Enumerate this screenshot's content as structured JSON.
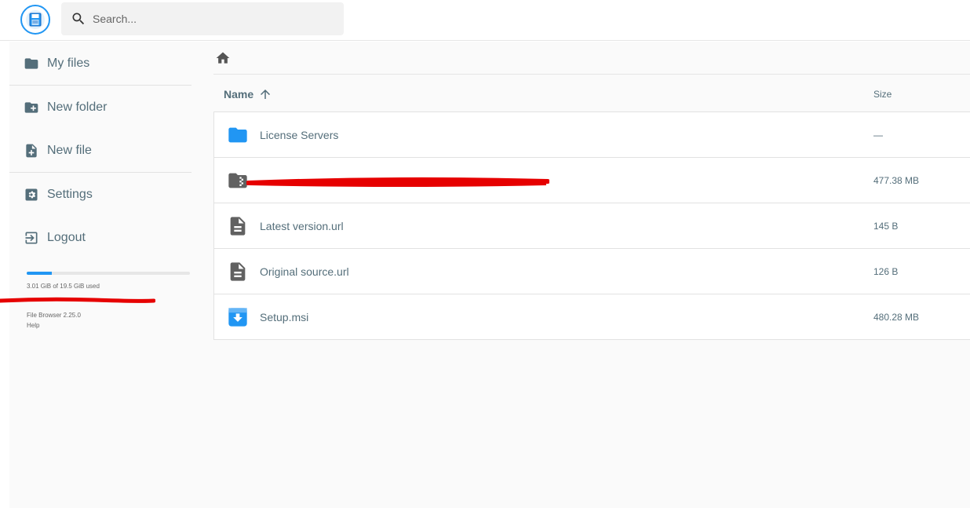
{
  "header": {
    "search_placeholder": "Search..."
  },
  "sidebar": {
    "items": [
      {
        "label": "My files",
        "icon": "folder-icon"
      },
      {
        "label": "New folder",
        "icon": "create-new-folder-icon"
      },
      {
        "label": "New file",
        "icon": "note-add-icon"
      },
      {
        "label": "Settings",
        "icon": "settings-icon"
      },
      {
        "label": "Logout",
        "icon": "logout-icon"
      }
    ],
    "usage": {
      "text": "3.01 GiB of 19.5 GiB used",
      "fraction": 0.154
    },
    "version": "File Browser 2.25.0",
    "help": "Help"
  },
  "list": {
    "header": {
      "name": "Name",
      "size": "Size"
    },
    "rows": [
      {
        "name": "License Servers",
        "size": "—",
        "icon": "folder-icon"
      },
      {
        "name": "",
        "size": "477.38 MB",
        "icon": "archive-icon"
      },
      {
        "name": "Latest version.url",
        "size": "145 B",
        "icon": "file-icon"
      },
      {
        "name": "Original source.url",
        "size": "126 B",
        "icon": "file-icon"
      },
      {
        "name": "Setup.msi",
        "size": "480.28 MB",
        "icon": "installer-icon"
      }
    ]
  },
  "colors": {
    "accent": "#2196f3",
    "icon_gray": "#546e7a",
    "redaction": "#e60000"
  }
}
